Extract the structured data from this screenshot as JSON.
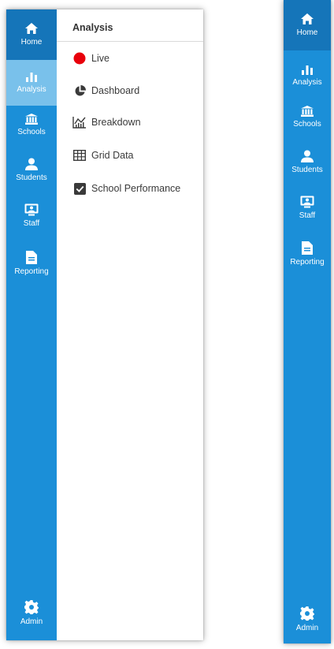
{
  "sidebar": {
    "items": [
      {
        "id": "home",
        "label": "Home",
        "icon": "home-icon"
      },
      {
        "id": "analysis",
        "label": "Analysis",
        "icon": "bar-chart-icon"
      },
      {
        "id": "schools",
        "label": "Schools",
        "icon": "institution-icon"
      },
      {
        "id": "students",
        "label": "Students",
        "icon": "user-icon"
      },
      {
        "id": "staff",
        "label": "Staff",
        "icon": "monitor-icon"
      },
      {
        "id": "reporting",
        "label": "Reporting",
        "icon": "document-icon"
      }
    ],
    "admin": {
      "label": "Admin",
      "icon": "gear-icon"
    },
    "active": "analysis"
  },
  "flyout": {
    "title": "Analysis",
    "items": [
      {
        "label": "Live",
        "icon": "red-dot-icon"
      },
      {
        "label": "Dashboard",
        "icon": "pie-chart-icon"
      },
      {
        "label": "Breakdown",
        "icon": "line-chart-icon"
      },
      {
        "label": "Grid Data",
        "icon": "table-icon"
      },
      {
        "label": "School Performance",
        "icon": "checkbox-icon"
      }
    ]
  },
  "colors": {
    "sidebar": "#1b8fd8",
    "home_bg": "#1575b9",
    "active_bg": "#79c1eb",
    "live_dot": "#e8000b"
  }
}
